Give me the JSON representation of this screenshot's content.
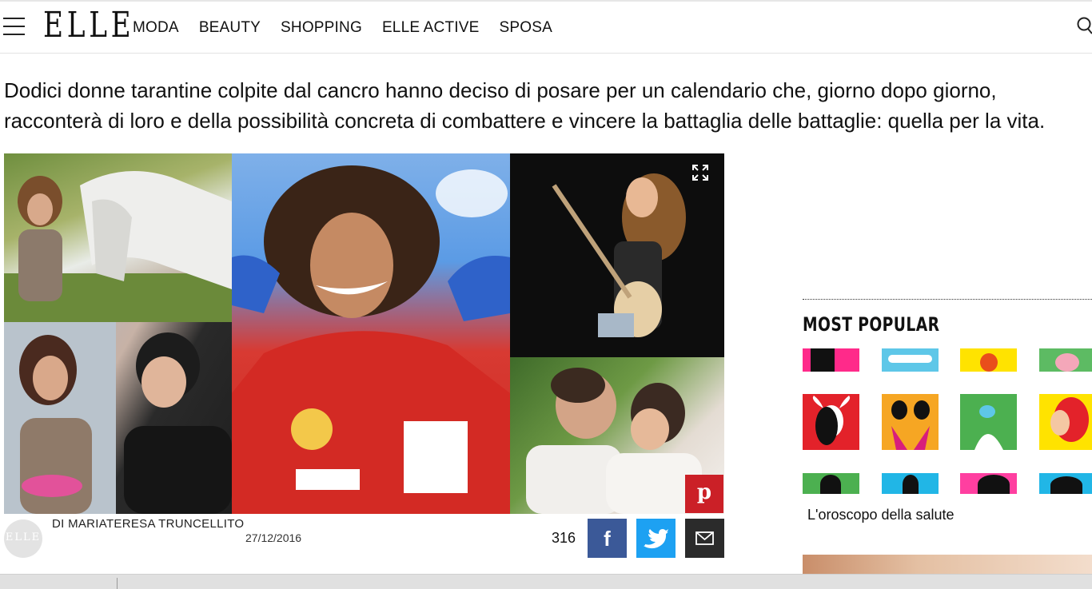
{
  "header": {
    "logo": "ELLE",
    "nav": [
      "MODA",
      "BEAUTY",
      "SHOPPING",
      "ELLE ACTIVE",
      "SPOSA"
    ]
  },
  "article": {
    "intro": "Dodici donne tarantine colpite dal cancro hanno deciso di posare per un calendario che, giorno dopo giorno, racconterà di loro e della possibilità concreta di combattere e vincere la battaglia delle battaglie: quella per la vita.",
    "byline": {
      "avatar_text": "ELLE",
      "author": "DI MARIATERESA TRUNCELLITO",
      "date": "27/12/2016",
      "share_count": "316"
    },
    "share": {
      "facebook_icon": "f",
      "pinterest_icon": "p"
    }
  },
  "sidebar": {
    "section_title": "MOST POPULAR",
    "item_label": "L'oroscopo della salute"
  },
  "colors": {
    "facebook": "#3b5998",
    "twitter": "#1da1f2",
    "email": "#2b2b2b",
    "pinterest": "#cb2027"
  }
}
